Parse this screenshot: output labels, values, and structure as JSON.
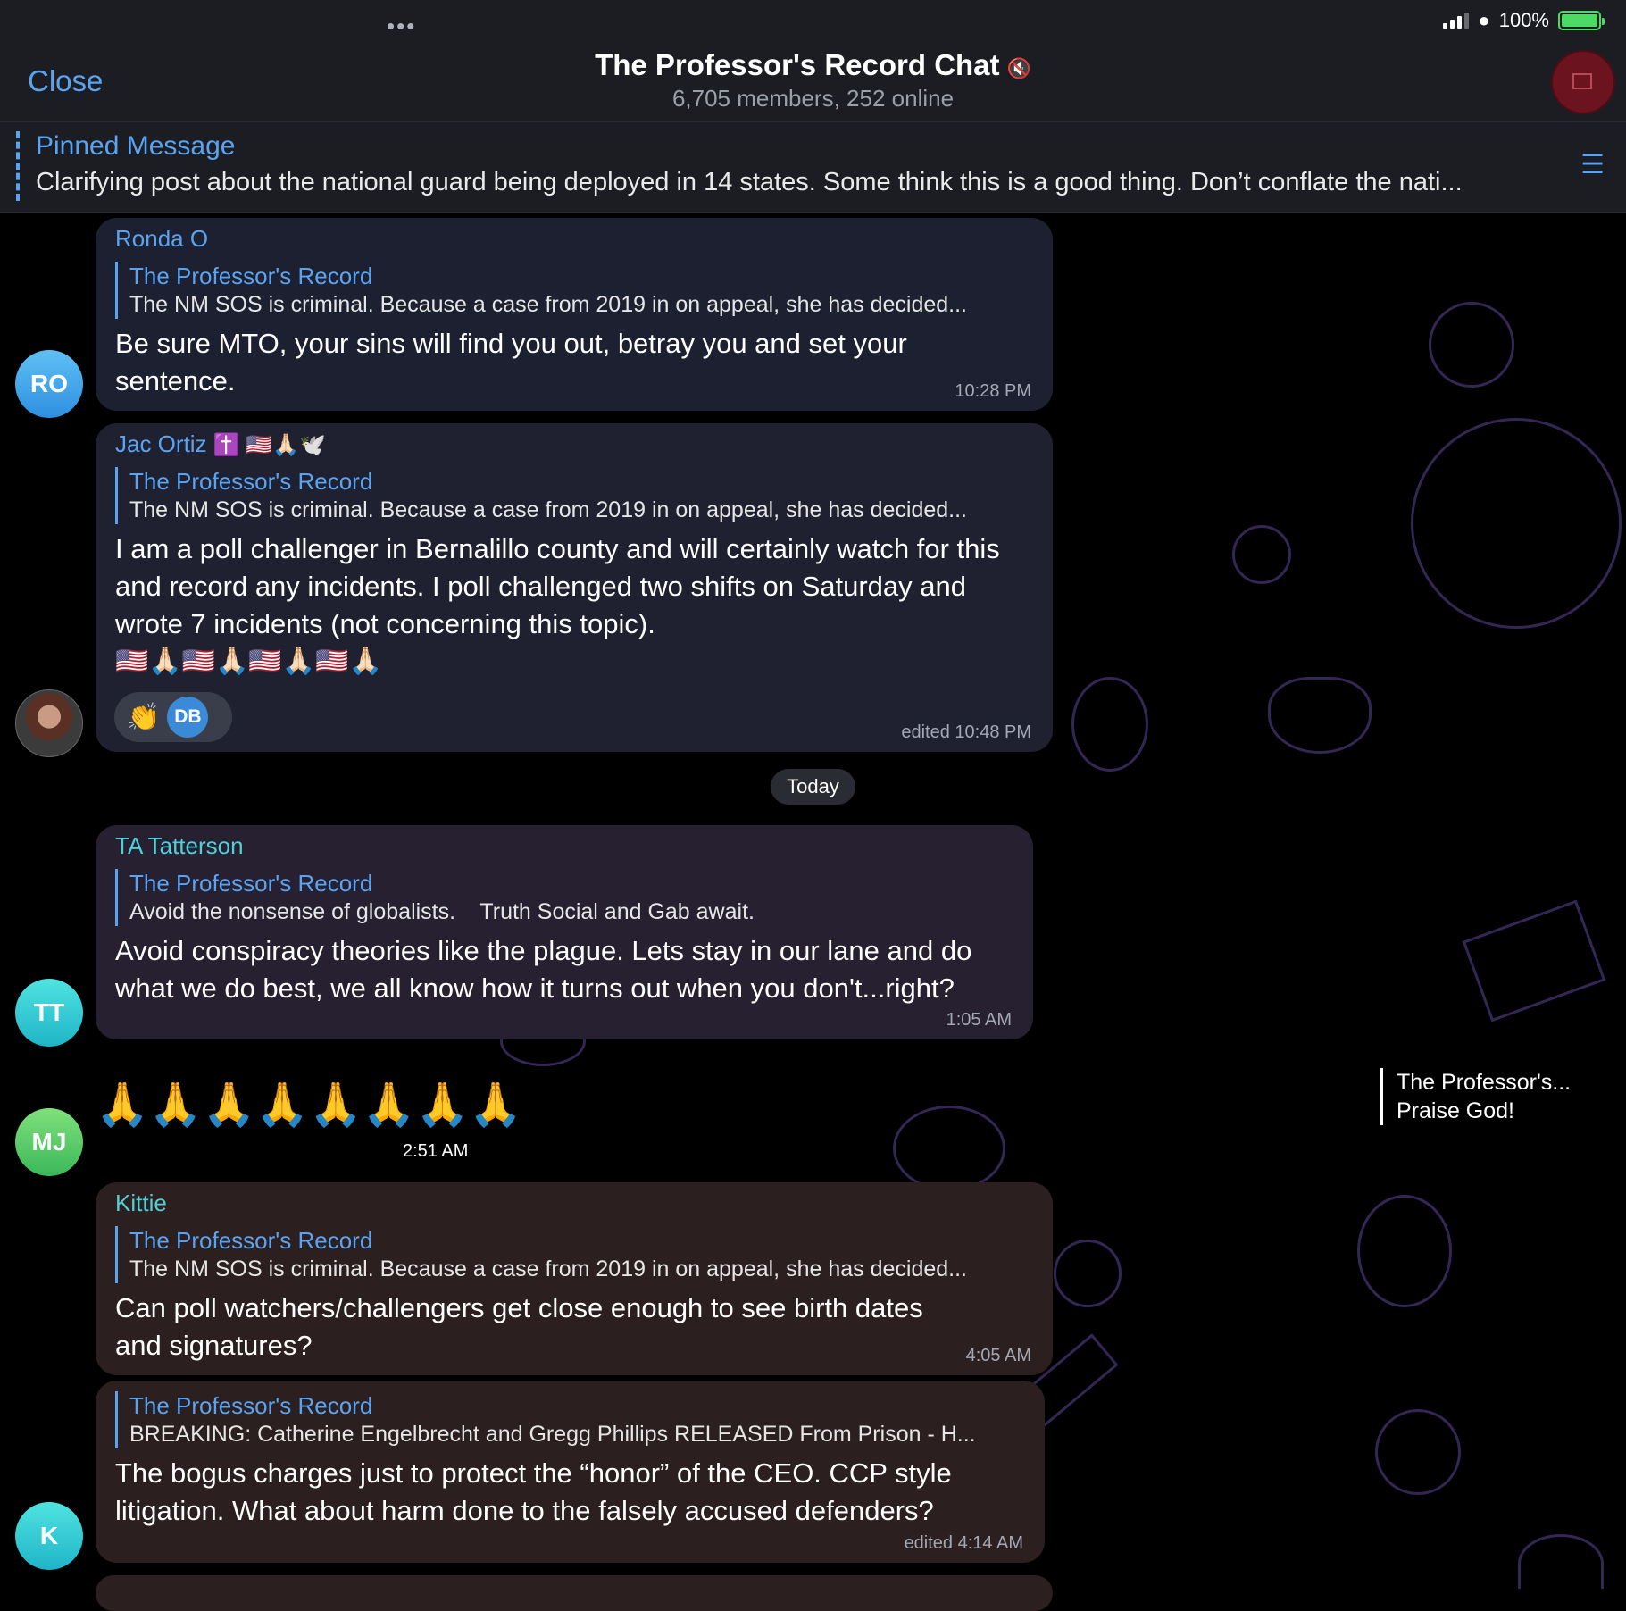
{
  "status": {
    "battery": "100%",
    "battery_level": 1.0
  },
  "header": {
    "close_label": "Close",
    "title": "The Professor's Record Chat",
    "subtitle": "6,705 members, 252 online",
    "more_icon": "•••",
    "mute_icon": "🔇"
  },
  "pinned": {
    "label": "Pinned Message",
    "text": "Clarifying post about the national guard being deployed in 14 states. Some think this is a good thing. Don’t conflate the nati..."
  },
  "date_separator": "Today",
  "messages": [
    {
      "avatar_text": "RO",
      "sender": "Ronda O",
      "reply_title": "The Professor's Record",
      "reply_text": "The NM SOS is criminal. Because a case from 2019 in on appeal, she has decided...",
      "text": "Be sure MTO, your sins will find you out, betray you and set your sentence.",
      "time": "10:28 PM"
    },
    {
      "sender": "Jac Ortiz",
      "sender_emoji": "✝️ 🇺🇸🙏🏻🕊️",
      "reply_title": "The Professor's Record",
      "reply_text": "The NM SOS is criminal. Because a case from 2019 in on appeal, she has decided...",
      "text": "I am a poll challenger in Bernalillo county and will certainly watch for this and record any incidents. I poll challenged two shifts on Saturday and wrote 7 incidents (not concerning this topic).",
      "emoji_line": "🇺🇸🙏🏻🇺🇸🙏🏻🇺🇸🙏🏻🇺🇸🙏🏻",
      "reaction_emoji": "👏",
      "reaction_user": "DB",
      "time": "edited 10:48 PM"
    },
    {
      "avatar_text": "TT",
      "sender": "TA Tatterson",
      "reply_title": "The Professor's Record",
      "reply_text": "Avoid the nonsense of globalists.    Truth Social and Gab await.",
      "text": "Avoid conspiracy theories like the plague. Lets stay in our lane and do what we do best, we all know how it turns out when you don't...right?",
      "time": "1:05 AM"
    },
    {
      "avatar_text": "MJ",
      "emoji_text": "🙏🙏🙏🙏🙏🙏🙏🙏",
      "time": "2:51 AM",
      "side_reply_title": "The Professor's...",
      "side_reply_text": "Praise God!"
    },
    {
      "sender": "Kittie",
      "reply_title": "The Professor's Record",
      "reply_text": "The NM SOS is criminal. Because a case from 2019 in on appeal, she has decided...",
      "text": "Can poll watchers/challengers get close enough to see birth dates and signatures?",
      "time": "4:05 AM"
    },
    {
      "avatar_text": "K",
      "reply_title": "The Professor's Record",
      "reply_text": "BREAKING: Catherine Engelbrecht and Gregg Phillips RELEASED From Prison - H...",
      "text": "The bogus charges just to protect the “honor” of the CEO. CCP style litigation. What about harm done to the falsely accused defenders?",
      "time": "edited 4:14 AM"
    }
  ],
  "colors": {
    "accent": "#5aa3f0",
    "bubble_blue": "#1c2030",
    "bubble_purple": "#2a1e2e",
    "bubble_brown": "#2c1f1f"
  }
}
